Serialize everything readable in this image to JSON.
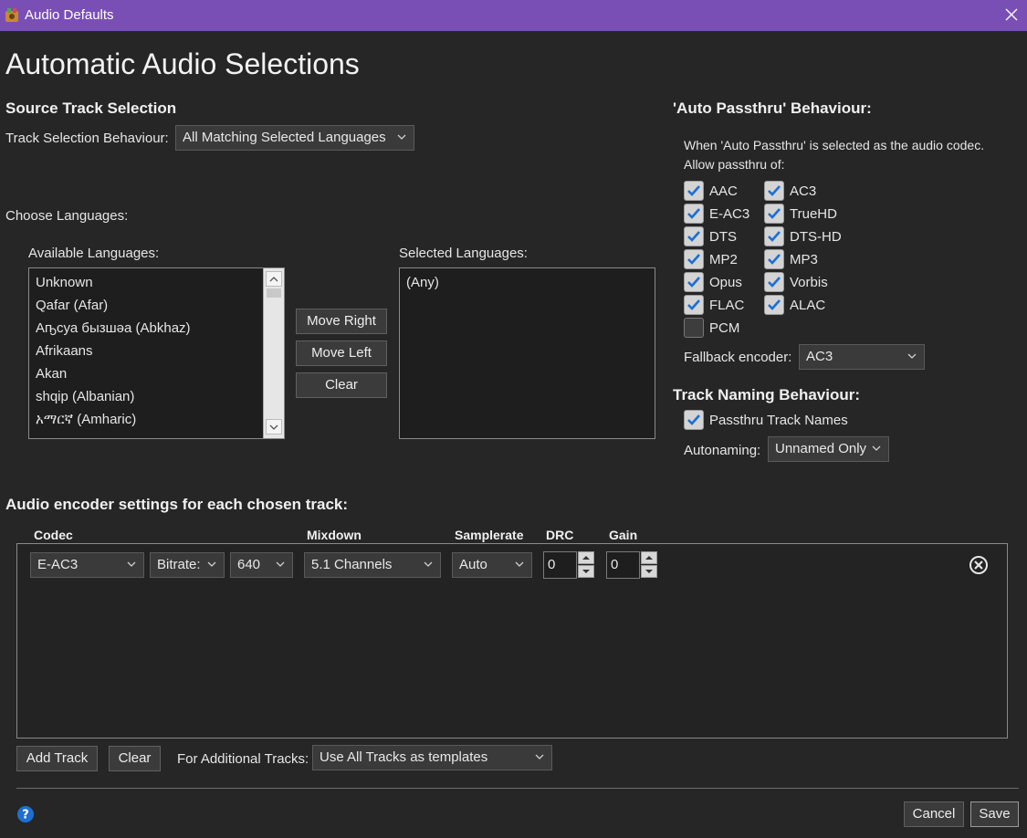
{
  "window": {
    "title": "Audio Defaults"
  },
  "page_title": "Automatic Audio Selections",
  "source": {
    "heading": "Source Track Selection",
    "behaviour_label": "Track Selection Behaviour:",
    "behaviour_value": "All Matching Selected Languages",
    "choose_languages": "Choose Languages:",
    "available_label": "Available Languages:",
    "selected_label": "Selected Languages:",
    "available": [
      "Unknown",
      "Qafar (Afar)",
      "Аҧсуа бызшәа (Abkhaz)",
      "Afrikaans",
      "Akan",
      "shqip (Albanian)",
      "አማርኛ (Amharic)"
    ],
    "selected": [
      "(Any)"
    ],
    "move_right": "Move Right",
    "move_left": "Move Left",
    "clear": "Clear"
  },
  "passthru": {
    "heading": "'Auto Passthru' Behaviour:",
    "desc1": "When 'Auto Passthru' is selected as the audio codec.",
    "desc2": "Allow passthru of:",
    "left": [
      {
        "label": "AAC",
        "checked": true
      },
      {
        "label": "E-AC3",
        "checked": true
      },
      {
        "label": "DTS",
        "checked": true
      },
      {
        "label": "MP2",
        "checked": true
      },
      {
        "label": "Opus",
        "checked": true
      },
      {
        "label": "FLAC",
        "checked": true
      },
      {
        "label": "PCM",
        "checked": false
      }
    ],
    "right": [
      {
        "label": "AC3",
        "checked": true
      },
      {
        "label": "TrueHD",
        "checked": true
      },
      {
        "label": "DTS-HD",
        "checked": true
      },
      {
        "label": "MP3",
        "checked": true
      },
      {
        "label": "Vorbis",
        "checked": true
      },
      {
        "label": "ALAC",
        "checked": true
      }
    ],
    "fallback_label": "Fallback encoder:",
    "fallback_value": "AC3"
  },
  "naming": {
    "heading": "Track Naming Behaviour:",
    "passthru_names": "Passthru Track Names",
    "autonaming_label": "Autonaming:",
    "autonaming_value": "Unnamed Only"
  },
  "encoder": {
    "heading": "Audio encoder settings for each chosen track:",
    "columns": {
      "codec": "Codec",
      "mixdown": "Mixdown",
      "samplerate": "Samplerate",
      "drc": "DRC",
      "gain": "Gain"
    },
    "track": {
      "codec": "E-AC3",
      "quality_mode": "Bitrate:",
      "bitrate": "640",
      "mixdown": "5.1 Channels",
      "samplerate": "Auto",
      "drc": "0",
      "gain": "0"
    },
    "add_track": "Add Track",
    "clear": "Clear",
    "additional_label": "For Additional Tracks:",
    "additional_value": "Use All Tracks as templates"
  },
  "footer": {
    "cancel": "Cancel",
    "save": "Save"
  },
  "colors": {
    "titlebar": "#7a4fb5",
    "background": "#262626",
    "check_accent": "#1a6fd6",
    "help_icon": "#1f6fd0"
  }
}
